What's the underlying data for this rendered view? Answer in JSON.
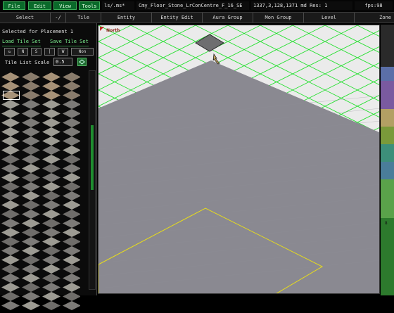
{
  "menu": {
    "file": "File",
    "edit": "Edit",
    "view": "View",
    "tools": "Tools",
    "path": "ls/.ms*",
    "asset": "Cmy_Floor_Stone_LrConCentre_F_16_SE",
    "coords": "1337,3,128,1371 md Res: 1",
    "fps": "fps:98"
  },
  "tabs": [
    "Select",
    "-/",
    "Tile",
    "Entity",
    "Entity Edit",
    "Aura Group",
    "Mon Group",
    "Level",
    "Zone"
  ],
  "panel": {
    "selected_label": "Selected for Placement 1",
    "load_tile_set": "Load Tile Set",
    "save_tile_set": "Save Tile Set",
    "small_buttons": [
      "",
      "N",
      "S",
      "",
      "W",
      "Non"
    ],
    "tile_list_label": "Tile List Scale",
    "tile_list_scale": "0.5",
    "tile_icon": "tile-grid-icon"
  },
  "viewport": {
    "north_label": "North",
    "colors": {
      "grid": "#1fe02a",
      "floor": "#8a8991",
      "selection": "#e7dc1b",
      "white": "#ebebeb"
    }
  },
  "swatches": [
    "#2a2a2a",
    "#5b6fa8",
    "#7a5aa0",
    "#b3a064",
    "#7a9a3a",
    "#3d8f7a",
    "#4a7d9a",
    "#5aa24a",
    "#2d7a2d"
  ],
  "swatch_label": "8"
}
